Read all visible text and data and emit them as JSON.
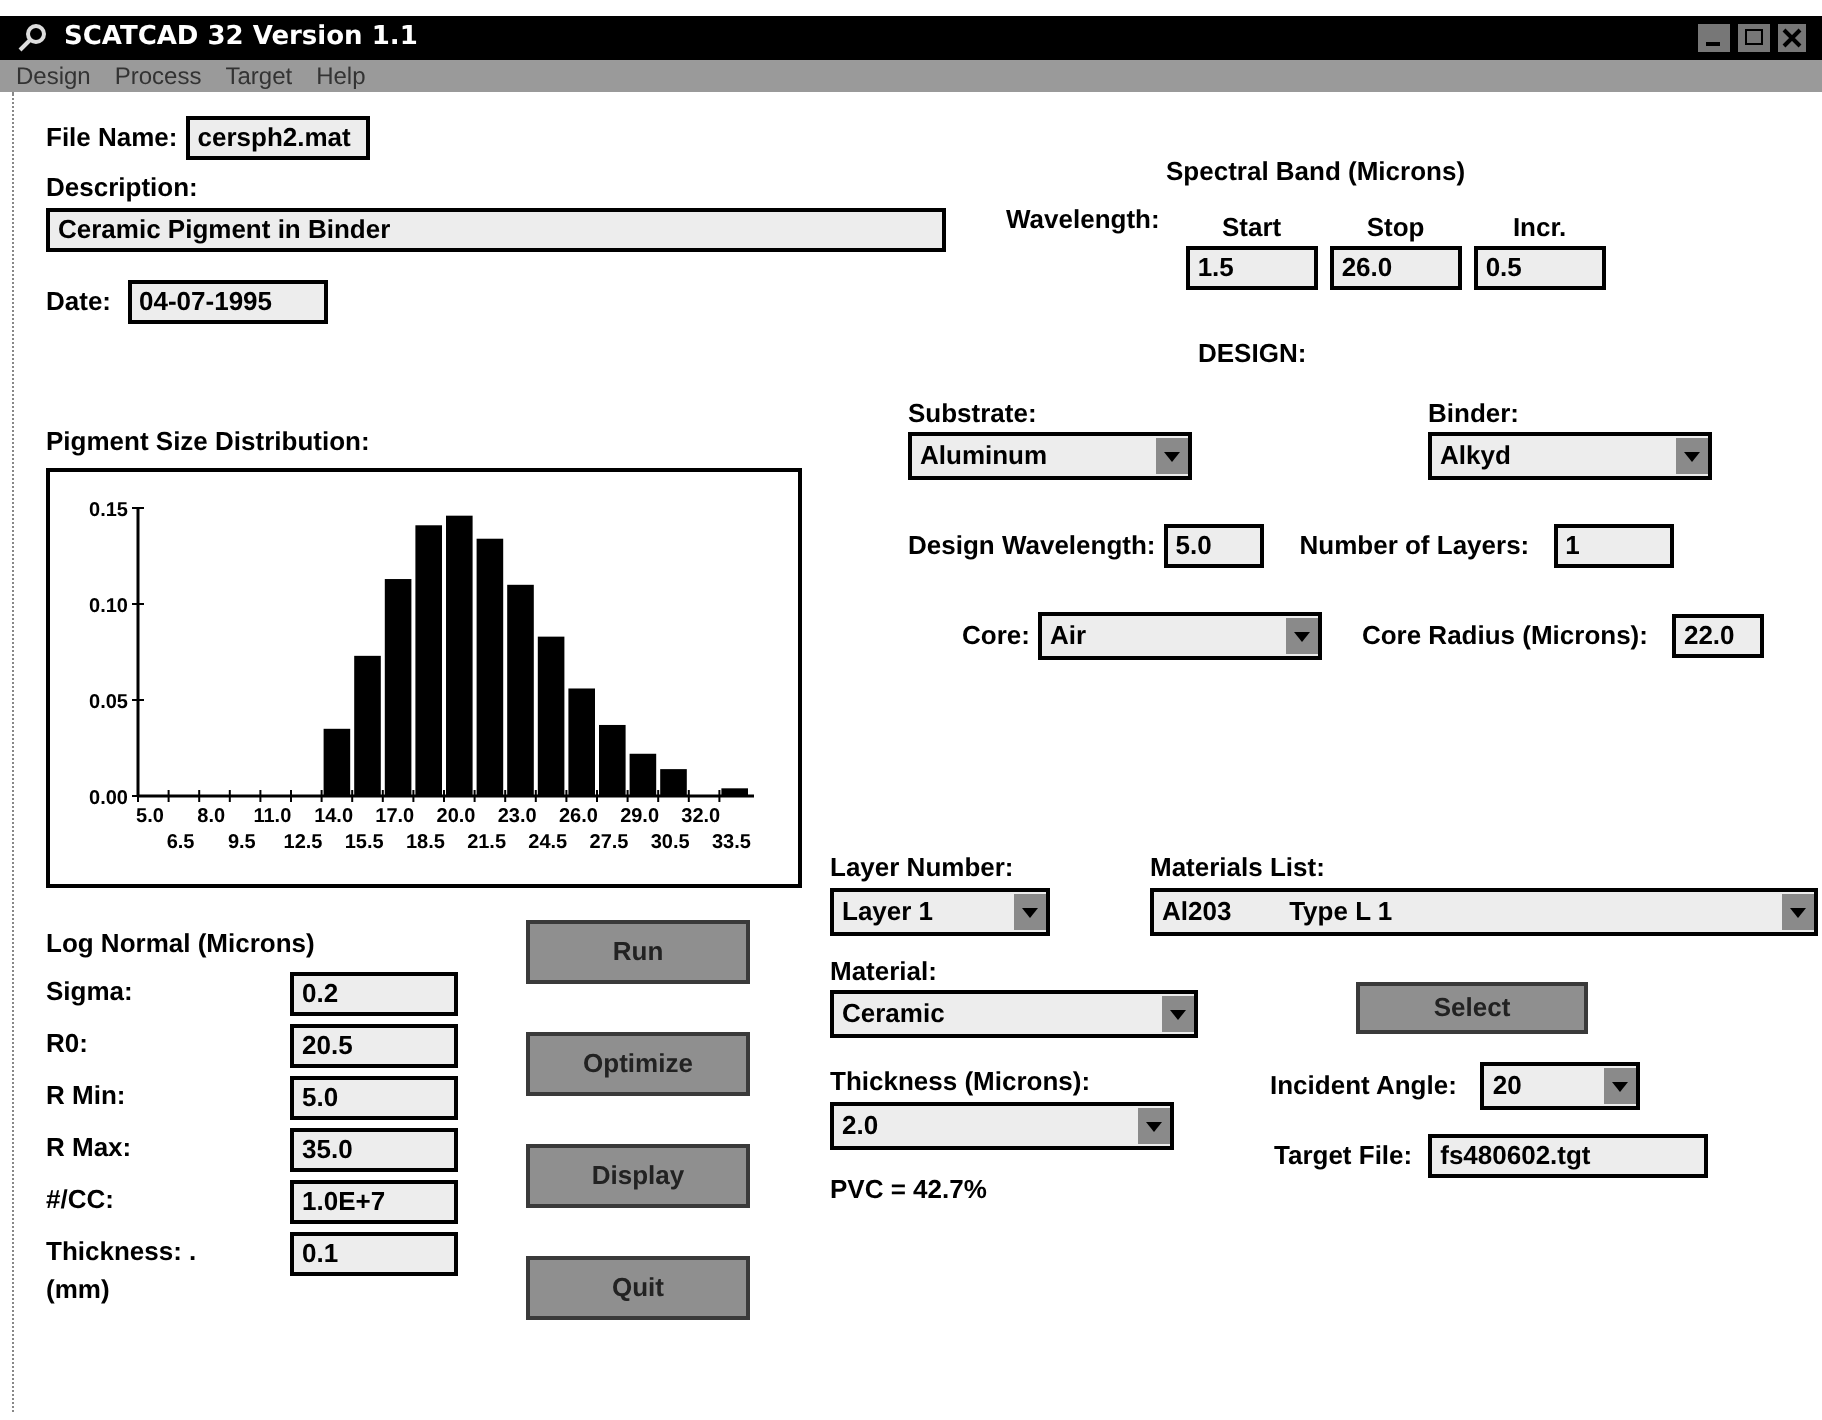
{
  "window": {
    "title": "SCATCAD 32 Version 1.1"
  },
  "menu": [
    "Design",
    "Process",
    "Target",
    "Help"
  ],
  "file_name": {
    "label": "File Name:",
    "value": "cersph2.mat"
  },
  "description": {
    "label": "Description:",
    "value": "Ceramic Pigment in Binder"
  },
  "date": {
    "label": "Date:",
    "value": "04-07-1995"
  },
  "spectral_band": {
    "title": "Spectral Band (Microns)",
    "row_label": "Wavelength:",
    "columns": [
      {
        "label": "Start",
        "value": "1.5"
      },
      {
        "label": "Stop",
        "value": "26.0"
      },
      {
        "label": "Incr.",
        "value": "0.5"
      }
    ]
  },
  "distribution": {
    "title": "Pigment Size Distribution:",
    "chart_data": {
      "type": "bar",
      "categories": [
        "5.0",
        "6.5",
        "8.0",
        "9.5",
        "11.0",
        "12.5",
        "14.0",
        "15.5",
        "17.0",
        "18.5",
        "20.0",
        "21.5",
        "23.0",
        "24.5",
        "26.0",
        "27.5",
        "29.0",
        "30.5",
        "32.0",
        "33.5"
      ],
      "values": [
        0,
        0,
        0,
        0,
        0,
        0,
        0.035,
        0.073,
        0.113,
        0.141,
        0.146,
        0.134,
        0.11,
        0.083,
        0.056,
        0.037,
        0.022,
        0.014,
        0,
        0.004
      ],
      "ylim": [
        0,
        0.15
      ],
      "yticks": [
        {
          "value": 0,
          "label": "0.00"
        },
        {
          "value": 0.05,
          "label": "0.05"
        },
        {
          "value": 0.1,
          "label": "0.10"
        },
        {
          "value": 0.15,
          "label": "0.15"
        }
      ]
    }
  },
  "design": {
    "title": "DESIGN:",
    "substrate": {
      "label": "Substrate:",
      "value": "Aluminum"
    },
    "binder": {
      "label": "Binder:",
      "value": "Alkyd"
    },
    "design_wavelength": {
      "label": "Design Wavelength:",
      "value": "5.0"
    },
    "number_of_layers": {
      "label": "Number of Layers:",
      "value": "1"
    },
    "core": {
      "label": "Core:",
      "value": "Air"
    },
    "core_radius": {
      "label": "Core Radius (Microns):",
      "value": "22.0"
    }
  },
  "log_normal": {
    "title": "Log Normal  (Microns)",
    "fields": [
      {
        "label": "Sigma:",
        "value": "0.2"
      },
      {
        "label": "R0:",
        "value": "20.5"
      },
      {
        "label": "R Min:",
        "value": "5.0"
      },
      {
        "label": "R Max:",
        "value": "35.0"
      },
      {
        "label": "#/CC:",
        "value": "1.0E+7"
      },
      {
        "label": "Thickness: .",
        "unit": "(mm)",
        "value": "0.1"
      }
    ]
  },
  "buttons": [
    "Run",
    "Optimize",
    "Display",
    "Quit"
  ],
  "layer": {
    "layer_number": {
      "label": "Layer Number:",
      "value": "Layer 1"
    },
    "materials_list": {
      "label": "Materials List:",
      "value": "Al203        Type L 1"
    },
    "material": {
      "label": "Material:",
      "value": "Ceramic"
    },
    "select_button": "Select",
    "thickness": {
      "label": "Thickness (Microns):",
      "value": "2.0"
    },
    "incident_angle": {
      "label": "Incident Angle:",
      "value": "20"
    },
    "pvc": "PVC = 42.7%",
    "target_file": {
      "label": "Target File:",
      "value": "fs480602.tgt"
    }
  }
}
